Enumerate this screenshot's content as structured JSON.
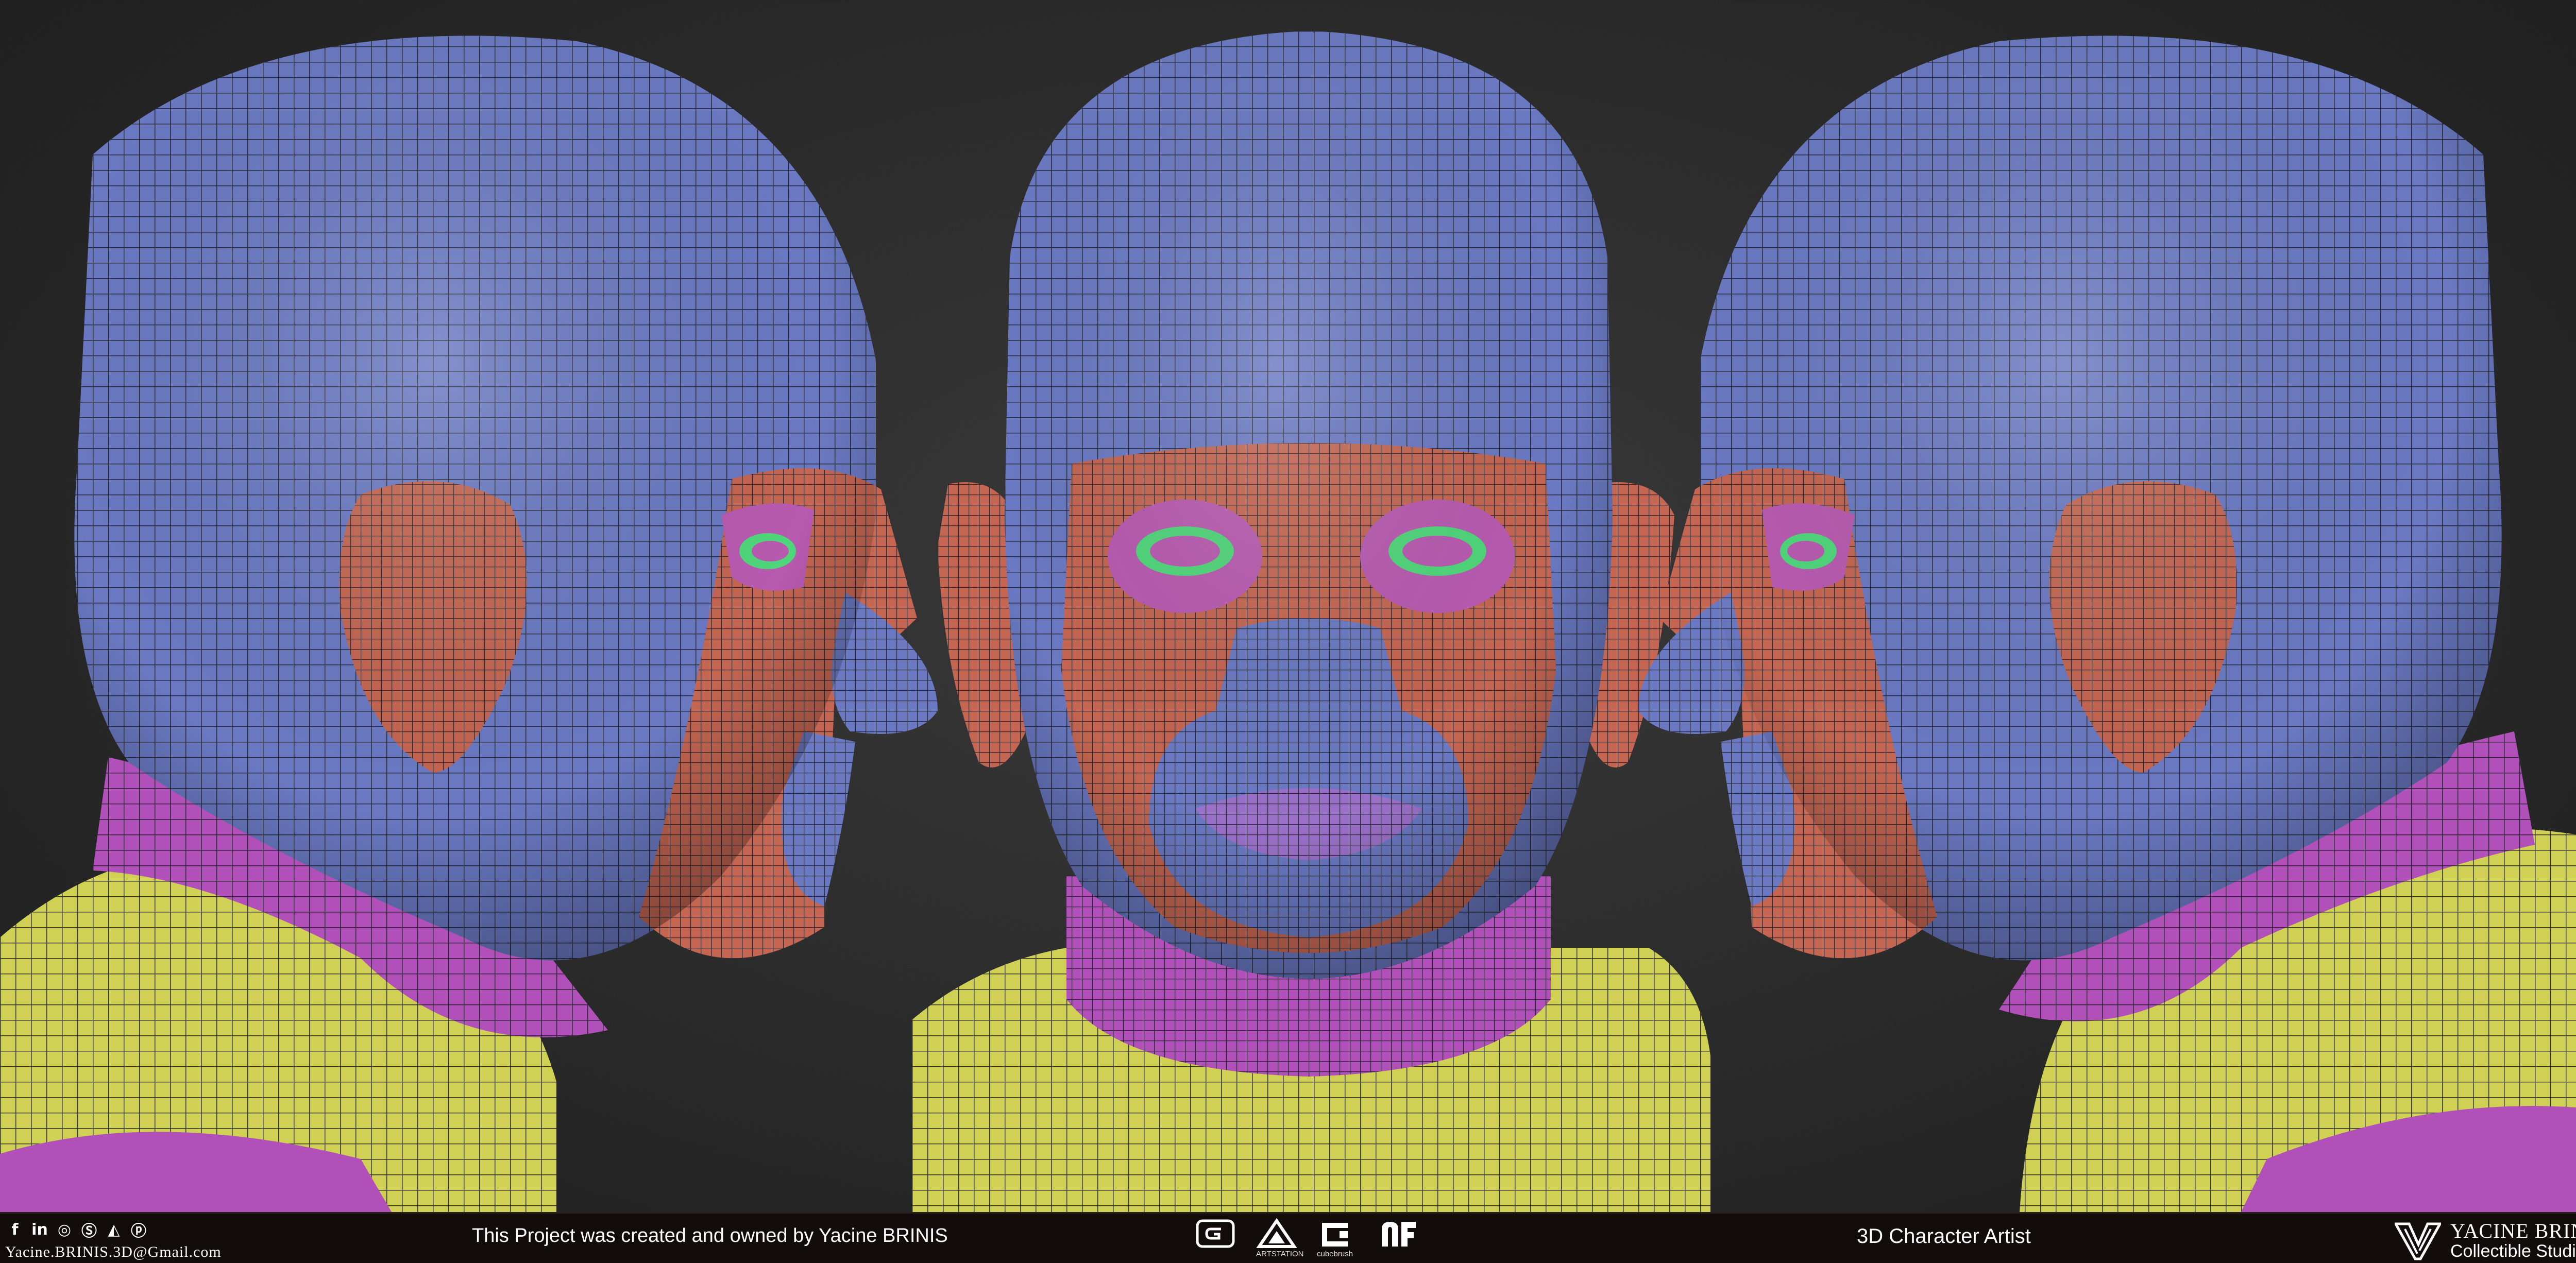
{
  "render": {
    "views": [
      "left-profile",
      "front",
      "right-profile"
    ],
    "colors": {
      "background": "#2b2b2b",
      "scalp_blue": "#6a79c2",
      "face_red": "#c46652",
      "eye_magenta": "#b85ab0",
      "neck_magenta": "#b050b8",
      "eye_green": "#4fd67a",
      "shoulder_yellow": "#cfd054",
      "wire": "#1c1c28"
    }
  },
  "footer": {
    "social_icons": [
      "facebook-icon",
      "linkedin-icon",
      "instagram-icon",
      "skype-icon",
      "artstation-icon",
      "pinterest-icon"
    ],
    "email": "Yacine.BRINIS.3D@Gmail.com",
    "credit": "This Project was created and owned by Yacine BRINIS",
    "software_logos": [
      {
        "icon": "gumroad-style-icon",
        "caption": ""
      },
      {
        "icon": "artstation-logo-icon",
        "caption": "ARTSTATION"
      },
      {
        "icon": "cubebrush-logo-icon",
        "caption": "cubebrush"
      },
      {
        "icon": "flippednormals-logo-icon",
        "caption": ""
      }
    ],
    "role": "3D Character Artist",
    "brand_name": "YACINE BRINIS",
    "brand_sub": "Collectible Studios"
  }
}
